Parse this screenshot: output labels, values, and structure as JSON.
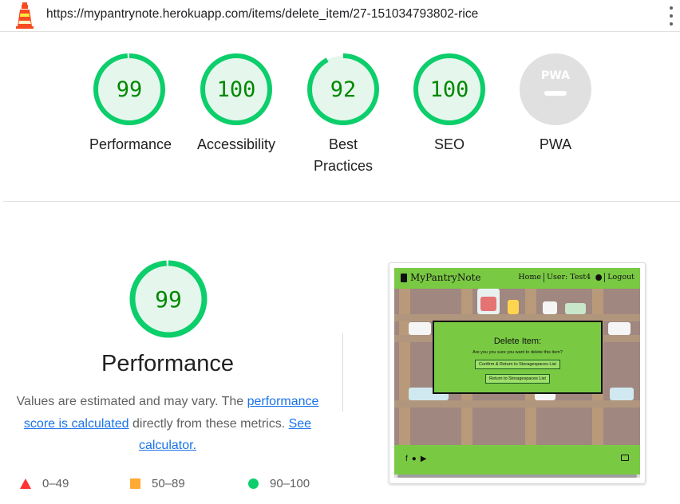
{
  "url": "https://mypantrynote.herokuapp.com/items/delete_item/27-151034793802-rice",
  "colors": {
    "pass": "#0cce6b",
    "pass_text": "#008800",
    "average": "#ffaa33",
    "fail": "#ff3333",
    "brand_green": "#7ac943"
  },
  "icons": {
    "logo": "lighthouse-icon",
    "menu": "more-vertical-icon"
  },
  "categories": [
    {
      "score": "99",
      "score_value": 99,
      "label": "Performance"
    },
    {
      "score": "100",
      "score_value": 100,
      "label": "Accessibility"
    },
    {
      "score": "92",
      "score_value": 92,
      "label": "Best Practices"
    },
    {
      "score": "100",
      "score_value": 100,
      "label": "SEO"
    }
  ],
  "pwa": {
    "badge": "PWA",
    "label": "PWA"
  },
  "performance": {
    "score": "99",
    "score_value": 99,
    "title": "Performance",
    "desc_1": "Values are estimated and may vary. The ",
    "link_1": "performance score is calculated",
    "desc_2": " directly from these metrics. ",
    "link_2": "See calculator."
  },
  "legend": [
    {
      "shape": "triangle",
      "range": "0–49"
    },
    {
      "shape": "square",
      "range": "50–89"
    },
    {
      "shape": "circle",
      "range": "90–100"
    }
  ],
  "thumbnail": {
    "brand": "MyPantryNote",
    "nav": [
      "Home",
      "User: Test4",
      "Logout"
    ],
    "modal_title": "Delete Item:",
    "modal_question": "Are you you sure you want to delete this item?",
    "confirm_button": "Confirm & Return to Storagespaces List",
    "return_button": "Return to Storagespaces List"
  }
}
